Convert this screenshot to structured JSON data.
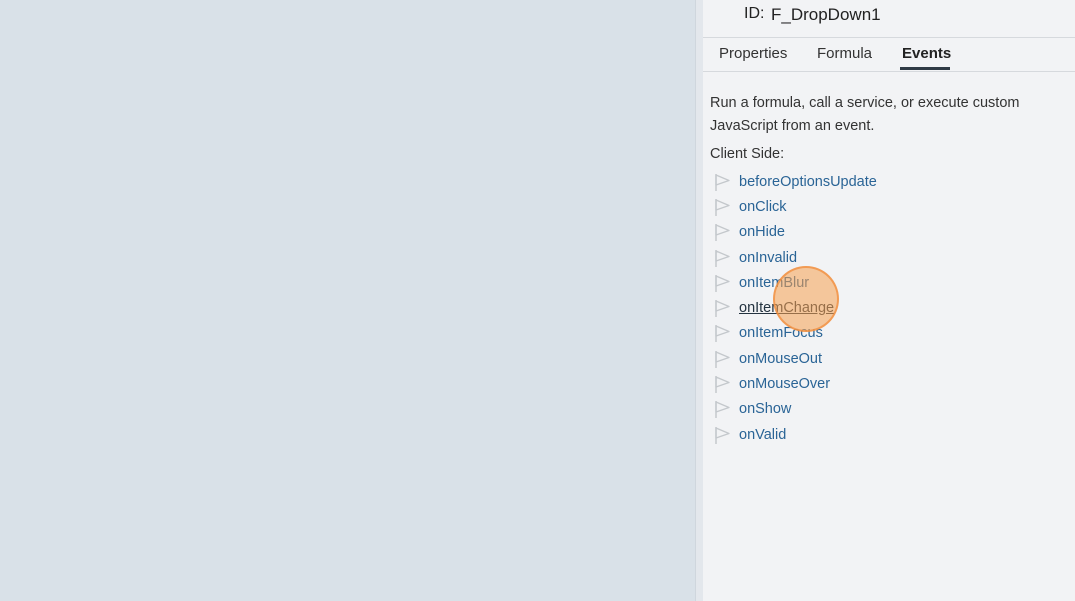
{
  "header": {
    "id_label": "ID:",
    "id_value": "F_DropDown1"
  },
  "tabs": [
    {
      "label": "Properties",
      "active": false
    },
    {
      "label": "Formula",
      "active": false
    },
    {
      "label": "Events",
      "active": true
    }
  ],
  "content": {
    "description": "Run a formula, call a service, or execute custom JavaScript from an event.",
    "section_title": "Client Side:"
  },
  "events": [
    {
      "label": "beforeOptionsUpdate"
    },
    {
      "label": "onClick"
    },
    {
      "label": "onHide"
    },
    {
      "label": "onInvalid"
    },
    {
      "label": "onItemBlur"
    },
    {
      "label": "onItemChange",
      "hovered": true
    },
    {
      "label": "onItemFocus"
    },
    {
      "label": "onMouseOut"
    },
    {
      "label": "onMouseOver"
    },
    {
      "label": "onShow"
    },
    {
      "label": "onValid"
    }
  ],
  "icons": {
    "event_marker": "flag-icon"
  },
  "colors": {
    "link": "#2a6496",
    "panel_bg": "#f2f3f5",
    "canvas_bg": "#d9e1e8",
    "tab_underline": "#2f3a45"
  }
}
